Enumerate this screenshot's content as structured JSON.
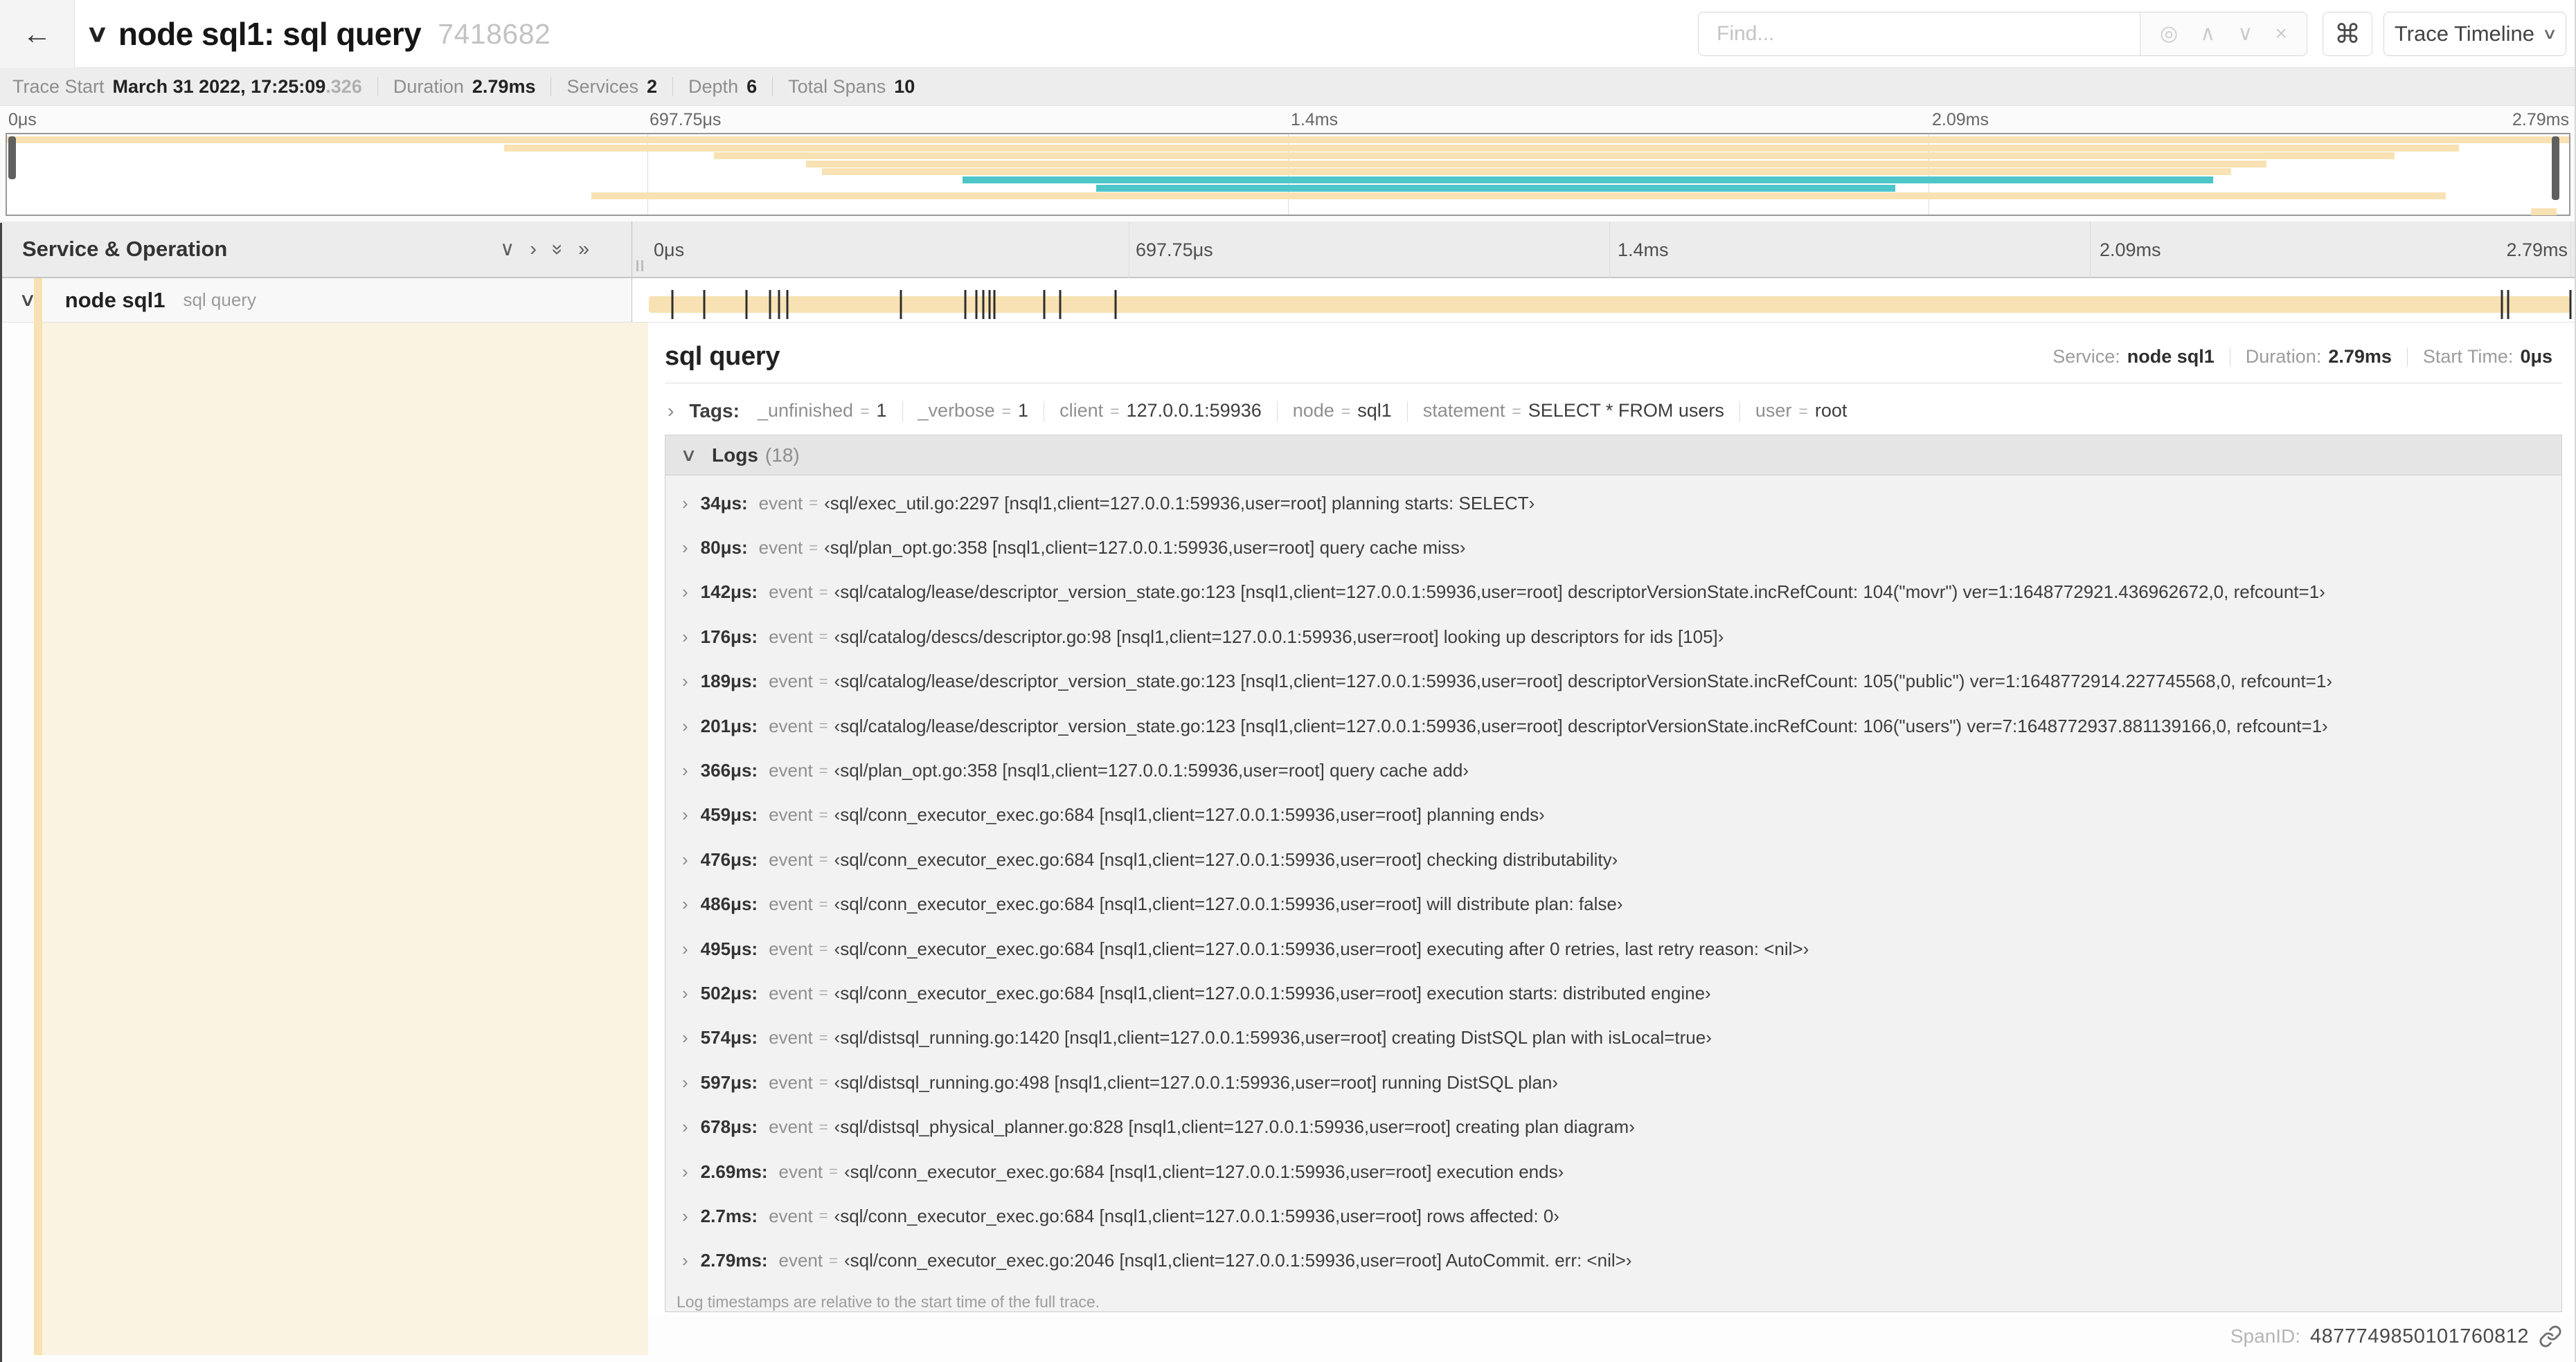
{
  "header": {
    "back_icon": "←",
    "collapse_icon": "∨",
    "title": "node sql1: sql query",
    "trace_id": "7418682",
    "find_placeholder": "Find...",
    "view_label": "Trace Timeline",
    "view_chevron": "∨"
  },
  "icons": {
    "locate": "◎",
    "prev": "∧",
    "next": "∨",
    "clear": "×",
    "command": "⌘",
    "chevron_down": "∨",
    "chevron_right": "›",
    "double_chevron": "»"
  },
  "trace_meta": {
    "items": [
      {
        "label": "Trace Start",
        "value": "March 31 2022, 17:25:09",
        "suffix": ".326"
      },
      {
        "label": "Duration",
        "value": "2.79ms"
      },
      {
        "label": "Services",
        "value": "2"
      },
      {
        "label": "Depth",
        "value": "6"
      },
      {
        "label": "Total Spans",
        "value": "10"
      }
    ]
  },
  "minimap": {
    "ticks": [
      "0μs",
      "697.75μs",
      "1.4ms",
      "2.09ms",
      "2.79ms"
    ],
    "spans": [
      {
        "row": 0,
        "start": 0.0,
        "end": 1.0,
        "color": "tan"
      },
      {
        "row": 1,
        "start": 0.194,
        "end": 0.957,
        "color": "tan"
      },
      {
        "row": 2,
        "start": 0.276,
        "end": 0.932,
        "color": "tan"
      },
      {
        "row": 3,
        "start": 0.312,
        "end": 0.882,
        "color": "tan"
      },
      {
        "row": 4,
        "start": 0.318,
        "end": 0.868,
        "color": "tan"
      },
      {
        "row": 5,
        "start": 0.373,
        "end": 0.861,
        "color": "teal"
      },
      {
        "row": 6,
        "start": 0.425,
        "end": 0.737,
        "color": "teal"
      },
      {
        "row": 7,
        "start": 0.228,
        "end": 0.952,
        "color": "tan"
      },
      {
        "row": 9,
        "start": 0.985,
        "end": 0.995,
        "color": "tan"
      }
    ]
  },
  "timeline": {
    "header_label": "Service & Operation",
    "ticks": [
      "0μs",
      "697.75μs",
      "1.4ms",
      "2.09ms",
      "2.79ms"
    ]
  },
  "span_row": {
    "service": "node sql1",
    "operation": "sql query",
    "total_us": 2790,
    "markers_us": [
      34,
      80,
      142,
      176,
      189,
      201,
      366,
      459,
      476,
      486,
      495,
      502,
      574,
      597,
      678,
      2690,
      2700,
      2790
    ]
  },
  "detail": {
    "title": "sql query",
    "meta": [
      {
        "label": "Service:",
        "value": "node sql1"
      },
      {
        "label": "Duration:",
        "value": "2.79ms"
      },
      {
        "label": "Start Time:",
        "value": "0μs"
      }
    ],
    "tags_label": "Tags:",
    "kv_separator": "=",
    "tags": [
      {
        "key": "_unfinished",
        "value": "1"
      },
      {
        "key": "_verbose",
        "value": "1"
      },
      {
        "key": "client",
        "value": "127.0.0.1:59936"
      },
      {
        "key": "node",
        "value": "sql1"
      },
      {
        "key": "statement",
        "value": "SELECT * FROM users"
      },
      {
        "key": "user",
        "value": "root"
      }
    ],
    "logs_label": "Logs",
    "logs_count": "(18)",
    "logs": [
      {
        "time": "34μs:",
        "field": "event",
        "value": "‹sql/exec_util.go:2297 [nsql1,client=127.0.0.1:59936,user=root] planning starts: SELECT›"
      },
      {
        "time": "80μs:",
        "field": "event",
        "value": "‹sql/plan_opt.go:358 [nsql1,client=127.0.0.1:59936,user=root] query cache miss›"
      },
      {
        "time": "142μs:",
        "field": "event",
        "value": "‹sql/catalog/lease/descriptor_version_state.go:123 [nsql1,client=127.0.0.1:59936,user=root] descriptorVersionState.incRefCount: 104(\"movr\") ver=1:1648772921.436962672,0, refcount=1›"
      },
      {
        "time": "176μs:",
        "field": "event",
        "value": "‹sql/catalog/descs/descriptor.go:98 [nsql1,client=127.0.0.1:59936,user=root] looking up descriptors for ids [105]›"
      },
      {
        "time": "189μs:",
        "field": "event",
        "value": "‹sql/catalog/lease/descriptor_version_state.go:123 [nsql1,client=127.0.0.1:59936,user=root] descriptorVersionState.incRefCount: 105(\"public\") ver=1:1648772914.227745568,0, refcount=1›"
      },
      {
        "time": "201μs:",
        "field": "event",
        "value": "‹sql/catalog/lease/descriptor_version_state.go:123 [nsql1,client=127.0.0.1:59936,user=root] descriptorVersionState.incRefCount: 106(\"users\") ver=7:1648772937.881139166,0, refcount=1›"
      },
      {
        "time": "366μs:",
        "field": "event",
        "value": "‹sql/plan_opt.go:358 [nsql1,client=127.0.0.1:59936,user=root] query cache add›"
      },
      {
        "time": "459μs:",
        "field": "event",
        "value": "‹sql/conn_executor_exec.go:684 [nsql1,client=127.0.0.1:59936,user=root] planning ends›"
      },
      {
        "time": "476μs:",
        "field": "event",
        "value": "‹sql/conn_executor_exec.go:684 [nsql1,client=127.0.0.1:59936,user=root] checking distributability›"
      },
      {
        "time": "486μs:",
        "field": "event",
        "value": "‹sql/conn_executor_exec.go:684 [nsql1,client=127.0.0.1:59936,user=root] will distribute plan: false›"
      },
      {
        "time": "495μs:",
        "field": "event",
        "value": "‹sql/conn_executor_exec.go:684 [nsql1,client=127.0.0.1:59936,user=root] executing after 0 retries, last retry reason: <nil>›"
      },
      {
        "time": "502μs:",
        "field": "event",
        "value": "‹sql/conn_executor_exec.go:684 [nsql1,client=127.0.0.1:59936,user=root] execution starts: distributed engine›"
      },
      {
        "time": "574μs:",
        "field": "event",
        "value": "‹sql/distsql_running.go:1420 [nsql1,client=127.0.0.1:59936,user=root] creating DistSQL plan with isLocal=true›"
      },
      {
        "time": "597μs:",
        "field": "event",
        "value": "‹sql/distsql_running.go:498 [nsql1,client=127.0.0.1:59936,user=root] running DistSQL plan›"
      },
      {
        "time": "678μs:",
        "field": "event",
        "value": "‹sql/distsql_physical_planner.go:828 [nsql1,client=127.0.0.1:59936,user=root] creating plan diagram›"
      },
      {
        "time": "2.69ms:",
        "field": "event",
        "value": "‹sql/conn_executor_exec.go:684 [nsql1,client=127.0.0.1:59936,user=root] execution ends›"
      },
      {
        "time": "2.7ms:",
        "field": "event",
        "value": "‹sql/conn_executor_exec.go:684 [nsql1,client=127.0.0.1:59936,user=root] rows affected: 0›"
      },
      {
        "time": "2.79ms:",
        "field": "event",
        "value": "‹sql/conn_executor_exec.go:2046 [nsql1,client=127.0.0.1:59936,user=root] AutoCommit. err: <nil>›"
      }
    ],
    "logs_note": "Log timestamps are relative to the start time of the full trace.",
    "span_id_label": "SpanID:",
    "span_id_value": "4877749850101760812"
  },
  "colors": {
    "tan": "#F8E2B3",
    "teal": "#4DC5C9"
  }
}
